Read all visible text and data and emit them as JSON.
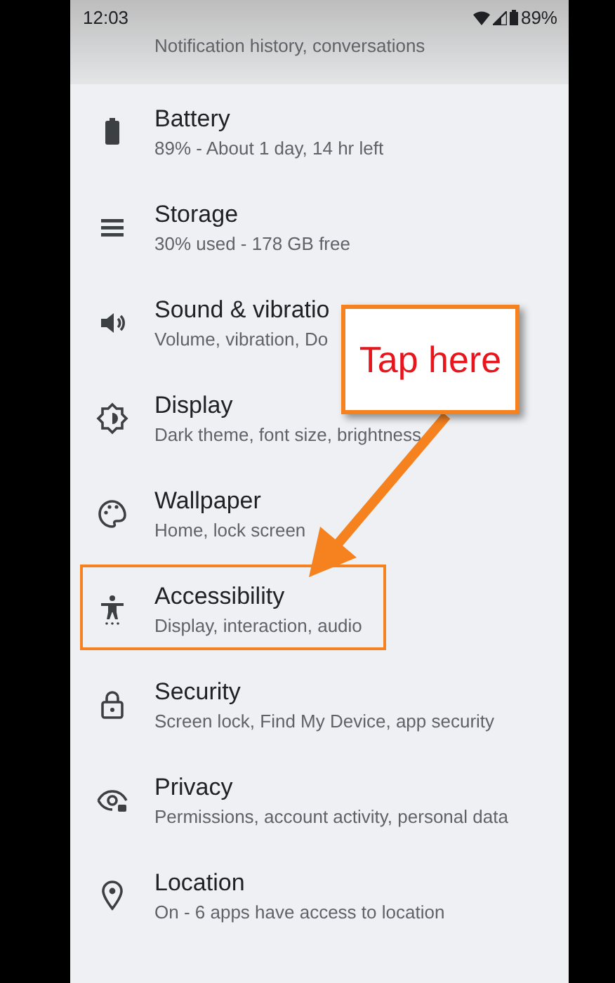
{
  "status_bar": {
    "time": "12:03",
    "battery": "89%"
  },
  "partial_item": {
    "subtitle": "Notification history, conversations"
  },
  "items": [
    {
      "kind": "battery",
      "title": "Battery",
      "subtitle": "89% - About 1 day, 14 hr left",
      "highlighted": false
    },
    {
      "kind": "storage",
      "title": "Storage",
      "subtitle": "30% used - 178 GB free",
      "highlighted": false
    },
    {
      "kind": "sound",
      "title": "Sound & vibratio",
      "subtitle": "Volume, vibration, Do",
      "highlighted": false
    },
    {
      "kind": "display",
      "title": "Display",
      "subtitle": "Dark theme, font size, brightness",
      "highlighted": false
    },
    {
      "kind": "wallpaper",
      "title": "Wallpaper",
      "subtitle": "Home, lock screen",
      "highlighted": false
    },
    {
      "kind": "accessibility",
      "title": "Accessibility",
      "subtitle": "Display, interaction, audio",
      "highlighted": true
    },
    {
      "kind": "security",
      "title": "Security",
      "subtitle": "Screen lock, Find My Device, app security",
      "highlighted": false
    },
    {
      "kind": "privacy",
      "title": "Privacy",
      "subtitle": "Permissions, account activity, personal data",
      "highlighted": false
    },
    {
      "kind": "location",
      "title": "Location",
      "subtitle": "On - 6 apps have access to location",
      "highlighted": false
    }
  ],
  "callout": {
    "text": "Tap here"
  }
}
